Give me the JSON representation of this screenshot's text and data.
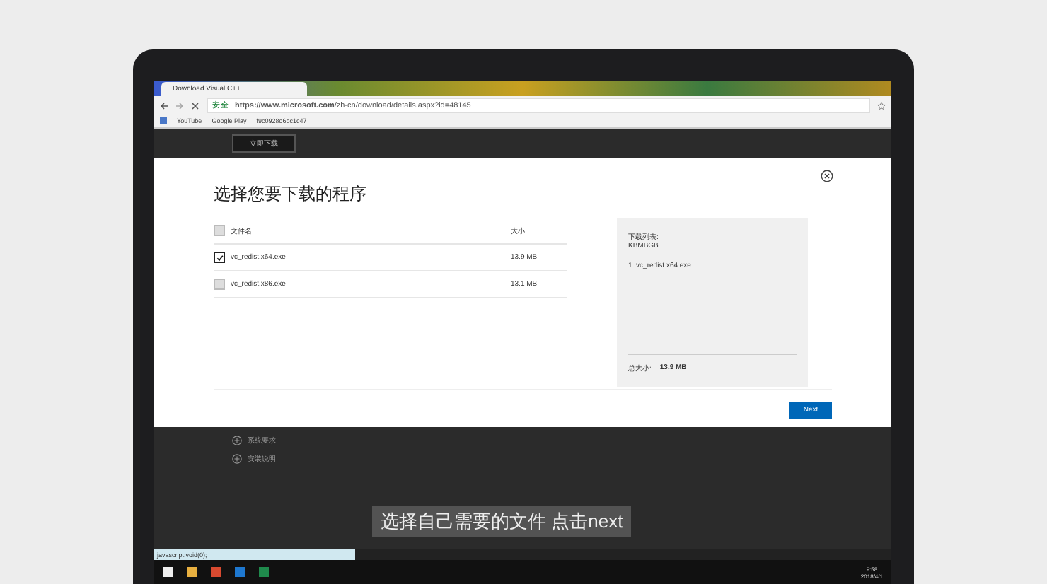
{
  "browser": {
    "tab_title": "Download Visual C++",
    "security": "安全",
    "url_host": "https://www.microsoft.com",
    "url_path": "/zh-cn/download/details.aspx?id=48145",
    "bookmarks": [
      "YouTube",
      "Google Play",
      "f9c0928d6bc1c47"
    ]
  },
  "page": {
    "download_button": "立即下载",
    "links": [
      "系统要求",
      "安装说明"
    ]
  },
  "dialog": {
    "title": "选择您要下载的程序",
    "header": {
      "name": "文件名",
      "size": "大小",
      "checked": false
    },
    "files": [
      {
        "name": "vc_redist.x64.exe",
        "size": "13.9 MB",
        "checked": true
      },
      {
        "name": "vc_redist.x86.exe",
        "size": "13.1 MB",
        "checked": false
      }
    ],
    "summary": {
      "title": "下载列表:",
      "subtitle": "KBMBGB",
      "items": [
        "1. vc_redist.x64.exe"
      ],
      "total_label": "总大小:",
      "total_value": "13.9 MB"
    },
    "next": "Next"
  },
  "status_bar": "javascript:void(0);",
  "taskbar": {
    "time": "9:58",
    "date": "2018/4/1"
  },
  "caption": "选择自己需要的文件 点击next"
}
